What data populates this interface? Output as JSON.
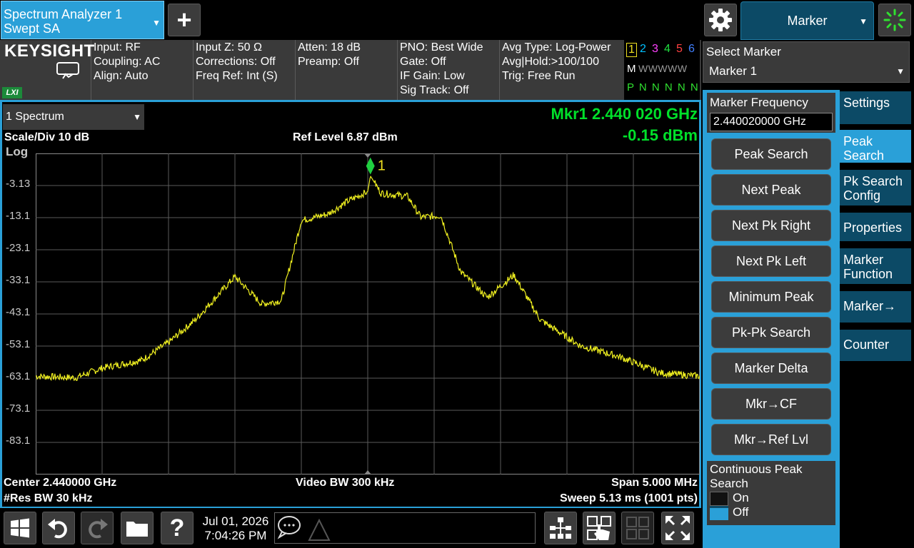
{
  "app": {
    "name_line1": "Spectrum Analyzer 1",
    "name_line2": "Swept SA"
  },
  "brand": {
    "logo": "KEYSIGHT",
    "lxi": "LXI"
  },
  "settings": {
    "col1": [
      "Input: RF",
      "Coupling: AC",
      "Align: Auto"
    ],
    "col2": [
      "Input Z: 50 Ω",
      "Corrections: Off",
      "Freq Ref: Int (S)"
    ],
    "col3": [
      "Atten: 18 dB",
      "Preamp: Off"
    ],
    "col4": [
      "PNO: Best Wide",
      "Gate: Off",
      "IF Gain: Low",
      "Sig Track: Off"
    ],
    "col5": [
      "Avg Type: Log-Power",
      "Avg|Hold:>100/100",
      "Trig: Free Run"
    ]
  },
  "trace_indicator": {
    "numbers": [
      "1",
      "2",
      "3",
      "4",
      "5",
      "6"
    ],
    "number_colors": [
      "#f0e020",
      "#00c0ff",
      "#ff40ff",
      "#20e040",
      "#ff4040",
      "#4080ff"
    ],
    "row2_label": "M",
    "row2": "WWWWW",
    "row3": "P N N N N N"
  },
  "header": {
    "menu_title": "Marker"
  },
  "right_panel": {
    "select_marker_label": "Select Marker",
    "select_marker_value": "Marker 1",
    "marker_freq_label": "Marker Frequency",
    "marker_freq_value": "2.440020000 GHz",
    "buttons": [
      "Peak Search",
      "Next Peak",
      "Next Pk Right",
      "Next Pk Left",
      "Minimum Peak",
      "Pk-Pk Search",
      "Marker Delta",
      "Mkr→CF",
      "Mkr→Ref Lvl"
    ],
    "continuous_label": "Continuous Peak Search",
    "continuous_on": "On",
    "continuous_off": "Off",
    "tabs": [
      "Settings",
      "Peak Search",
      "Pk Search Config",
      "Properties",
      "Marker Function",
      "Marker→",
      "Counter"
    ],
    "active_tab": "Peak Search"
  },
  "display": {
    "window_select": "1 Spectrum",
    "scale": "Scale/Div 10 dB",
    "log": "Log",
    "ref_level": "Ref Level 6.87 dBm",
    "marker_line1": "Mkr1  2.440 020 GHz",
    "marker_line2": "-0.15 dBm",
    "center": "Center 2.440000 GHz",
    "video_bw": "Video BW 300 kHz",
    "span": "Span 5.000 MHz",
    "res_bw": "#Res BW 30 kHz",
    "sweep": "Sweep 5.13 ms (1001 pts)",
    "y_labels": [
      "-3.13",
      "-13.1",
      "-23.1",
      "-33.1",
      "-43.1",
      "-53.1",
      "-63.1",
      "-73.1",
      "-83.1"
    ],
    "marker_label": "1"
  },
  "chart_data": {
    "type": "line",
    "xlabel": "",
    "ylabel": "",
    "x_unit": "GHz",
    "y_unit": "dBm",
    "xlim": [
      2.4375,
      2.4425
    ],
    "ylim": [
      -93.13,
      6.87
    ],
    "grid": true,
    "series": [
      {
        "color": "#f0f020",
        "x": [
          2.4375,
          2.4378,
          2.438,
          2.4383,
          2.4385,
          2.4387,
          2.439,
          2.4392,
          2.43935,
          2.4395,
          2.4397,
          2.43985,
          2.44,
          2.44002,
          2.4401,
          2.4403,
          2.4404,
          2.44055,
          2.4407,
          2.4409,
          2.4411,
          2.4413,
          2.4416,
          2.4419,
          2.4422,
          2.4425
        ],
        "y": [
          -62.5,
          -63,
          -60,
          -57.5,
          -52,
          -45,
          -31.5,
          -40,
          -39,
          -14,
          -12,
          -8,
          -5,
          -0.15,
          -5.5,
          -6.5,
          -13,
          -12.5,
          -30,
          -38,
          -31,
          -45,
          -53,
          -56.5,
          -61.5,
          -62.5
        ]
      }
    ],
    "marker": {
      "x": 2.44002,
      "y": -0.15,
      "label": "1"
    }
  },
  "taskbar": {
    "date": "Jul 01, 2026",
    "time": "7:04:26 PM"
  }
}
